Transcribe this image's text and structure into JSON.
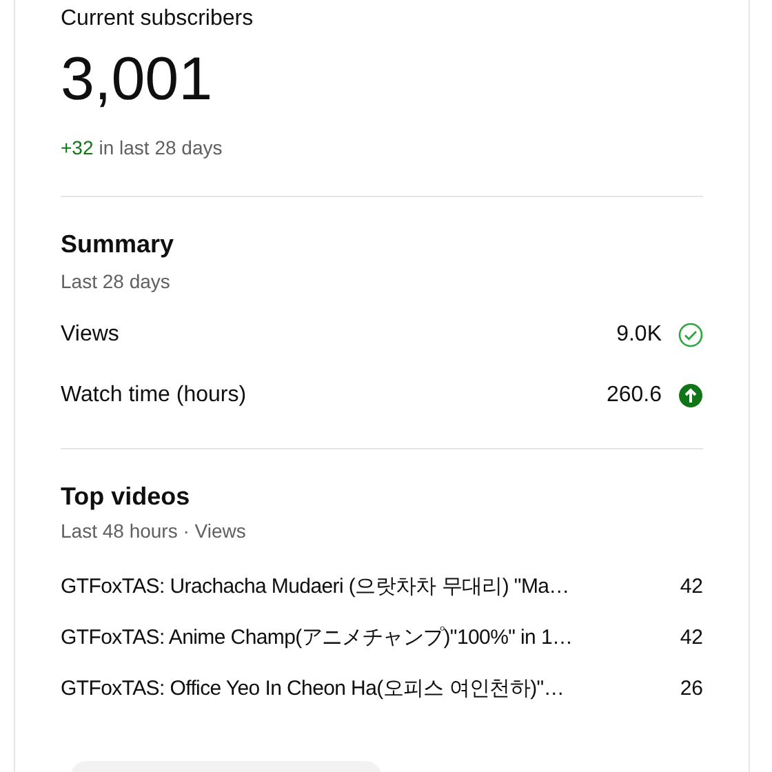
{
  "subscribers": {
    "label": "Current subscribers",
    "count": "3,001",
    "change": "+32",
    "change_note": "in last 28 days"
  },
  "summary": {
    "title": "Summary",
    "period": "Last 28 days",
    "metrics": [
      {
        "label": "Views",
        "value": "9.0K",
        "kind": "check"
      },
      {
        "label": "Watch time (hours)",
        "value": "260.6",
        "kind": "up"
      }
    ]
  },
  "top_videos": {
    "title": "Top videos",
    "period": "Last 48 hours · Views",
    "rows": [
      {
        "title": "GTFoxTAS: Urachacha Mudaeri (으랏차차 무대리) \"Ma…",
        "views": "42"
      },
      {
        "title": "GTFoxTAS: Anime Champ(アニメチャンプ)\"100%\" in 1…",
        "views": "42"
      },
      {
        "title": "GTFoxTAS: Office Yeo In Cheon Ha(오피스 여인천하)\"…",
        "views": "26"
      }
    ]
  }
}
